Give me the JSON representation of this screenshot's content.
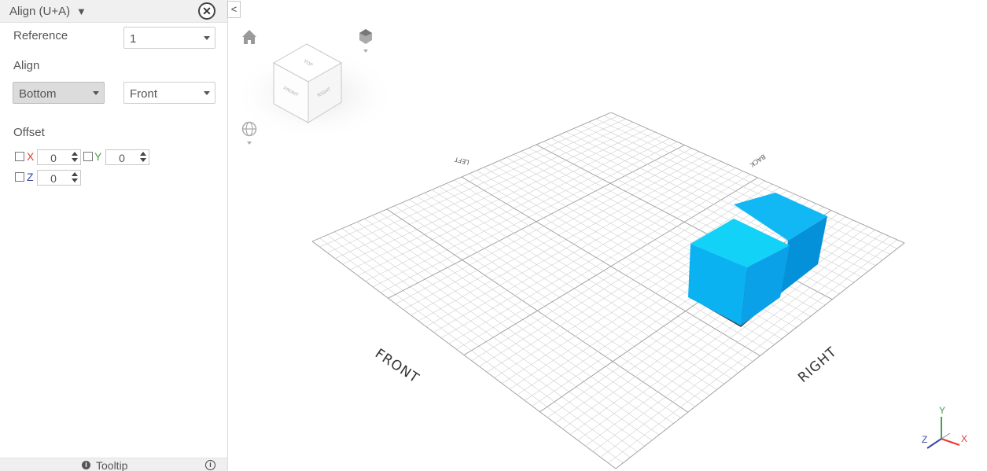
{
  "panel": {
    "title": "Align (U+A)",
    "title_caret": "▼",
    "close": "✕",
    "reference_label": "Reference",
    "reference_value": "1",
    "align_label": "Align",
    "align_vertical_value": "Bottom",
    "align_view_value": "Front",
    "offset_label": "Offset",
    "offset": {
      "x_label": "X",
      "x_value": "0",
      "y_label": "Y",
      "y_value": "0",
      "z_label": "Z",
      "z_value": "0"
    },
    "footer_tooltip": "Tooltip",
    "tooltip_icon": "i",
    "info_icon": "i"
  },
  "collapse": "<",
  "viewport": {
    "cube_faces": {
      "top": "TOP",
      "front": "FRONT",
      "right": "RIGHT"
    },
    "grid_labels": {
      "front": "FRONT",
      "right": "RIGHT",
      "left": "LEFT",
      "back": "BACK"
    },
    "triad": {
      "x": "X",
      "y": "Y",
      "z": "Z"
    }
  },
  "colors": {
    "axis_x": "#e53935",
    "axis_y": "#43a047",
    "axis_z": "#3949ab",
    "box_top": "#12c4f5",
    "box_front": "#0aaef0",
    "box_side": "#0597e0"
  }
}
